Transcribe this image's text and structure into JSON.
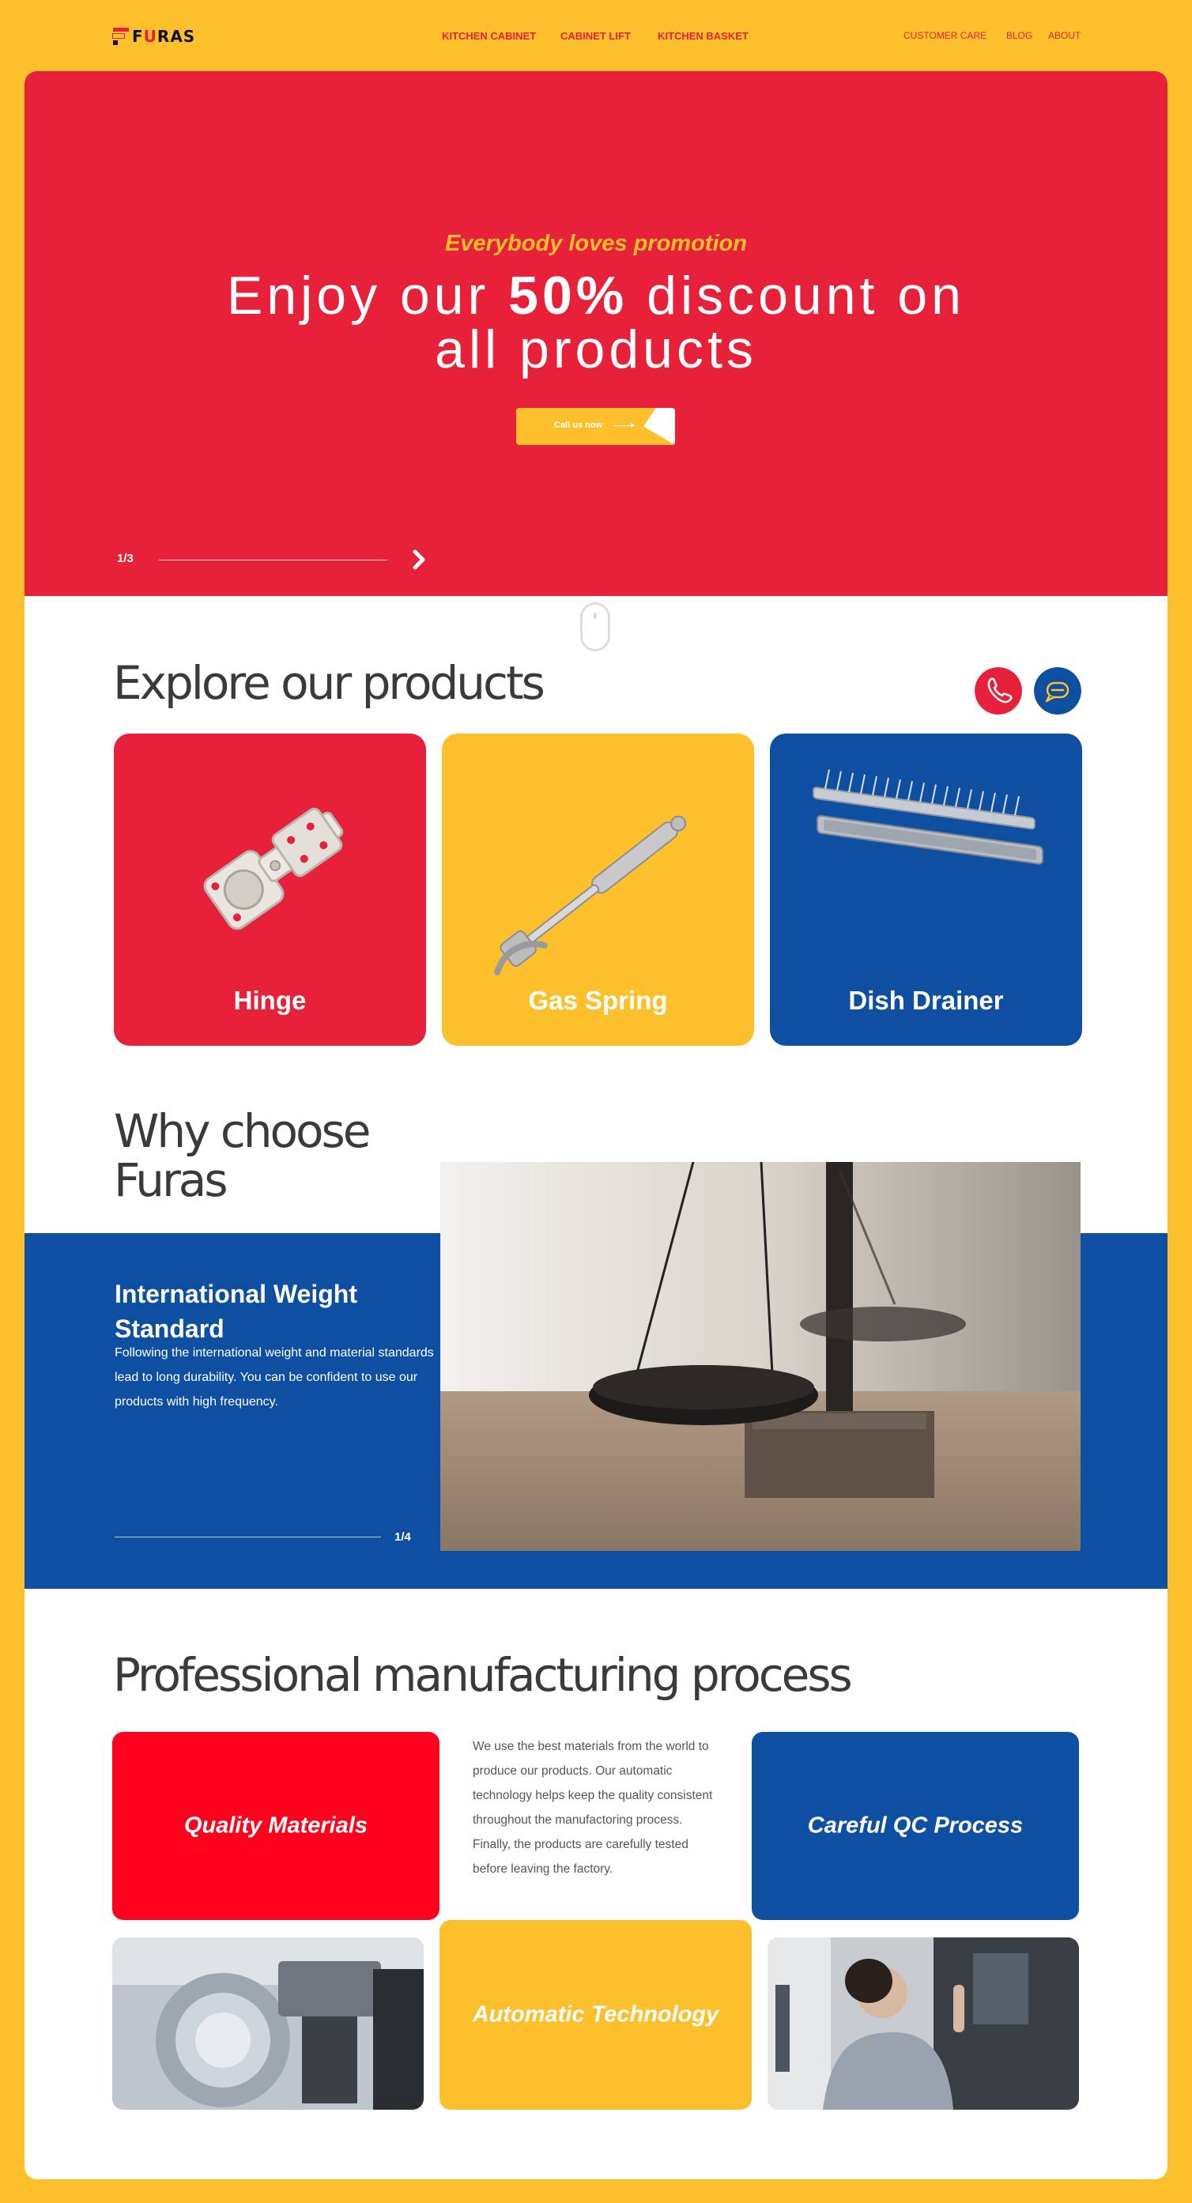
{
  "header": {
    "logo_text_prefix": "F",
    "logo_text_accent": "U",
    "logo_text_suffix": "RAS",
    "nav": [
      "KITCHEN CABINET",
      "CABINET LIFT",
      "KITCHEN BASKET"
    ],
    "nav_right": [
      "CUSTOMER CARE",
      "BLOG",
      "ABOUT"
    ]
  },
  "hero": {
    "kicker": "Everybody loves promotion",
    "title_before": "Enjoy our ",
    "title_bold": "50%",
    "title_after": " discount on",
    "title_line2": "all products",
    "cta_label": "Call us now",
    "pager": "1/3"
  },
  "products": {
    "heading": "Explore our products",
    "items": [
      {
        "name": "Hinge"
      },
      {
        "name": "Gas Spring"
      },
      {
        "name": "Dish Drainer"
      }
    ]
  },
  "why": {
    "heading_line1": "Why choose",
    "heading_line2": "Furas",
    "title": "International Weight Standard",
    "body": "Following the international weight and material standards lead to long durability. You can be confident to use our products with high frequency.",
    "pager": "1/4"
  },
  "process": {
    "heading": "Professional manufacturing process",
    "quality": "Quality Materials",
    "qc": "Careful QC Process",
    "automatic": "Automatic Technology",
    "body": "We use the best materials from the world to produce our products. Our automatic technology helps keep the quality consistent throughout the manufactoring process. Finally, the products are carefully tested before leaving the factory."
  },
  "colors": {
    "yellow": "#FDC02D",
    "red": "#E8213A",
    "blue": "#0F4FA1",
    "bright_red": "#FF001D"
  }
}
